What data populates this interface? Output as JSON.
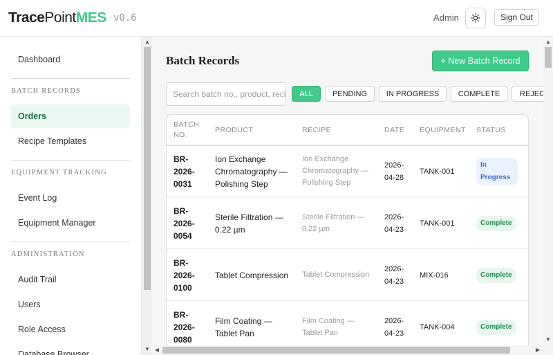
{
  "brand": {
    "part1": "Trace",
    "part2": "Point",
    "part3": "MES",
    "version": "v0.6"
  },
  "header": {
    "user": "Admin",
    "theme_icon": "sun-icon",
    "signout": "Sign Out"
  },
  "sidebar": {
    "dashboard": "Dashboard",
    "section_batch": "BATCH RECORDS",
    "orders": "Orders",
    "recipe_templates": "Recipe Templates",
    "section_equipment": "EQUIPMENT TRACKING",
    "event_log": "Event Log",
    "equipment_manager": "Equipment Manager",
    "section_admin": "ADMINISTRATION",
    "audit_trail": "Audit Trail",
    "users": "Users",
    "role_access": "Role Access",
    "database_browser": "Database Browser",
    "active_item": "Orders"
  },
  "main": {
    "title": "Batch Records",
    "new_button": "+ New Batch Record",
    "search_placeholder": "Search batch no., product, recipe",
    "filters": [
      "ALL",
      "PENDING",
      "IN PROGRESS",
      "COMPLETE",
      "REJECTED"
    ],
    "active_filter": "ALL"
  },
  "table": {
    "headers": {
      "batch": "BATCH NO.",
      "product": "PRODUCT",
      "recipe": "RECIPE",
      "date": "DATE",
      "equipment": "EQUIPMENT",
      "status": "STATUS"
    },
    "rows": [
      {
        "batch": "BR-2026-0031",
        "product": "Ion Exchange Chromatography — Polishing Step",
        "recipe": "Ion Exchange Chromatography — Polishing Step",
        "date": "2026-04-28",
        "equipment": "TANK-001",
        "status": "In Progress",
        "status_kind": "progress"
      },
      {
        "batch": "BR-2026-0054",
        "product": "Sterile Filtration — 0.22 µm",
        "recipe": "Sterile Filtration — 0.22 µm",
        "date": "2026-04-23",
        "equipment": "TANK-001",
        "status": "Complete",
        "status_kind": "complete"
      },
      {
        "batch": "BR-2026-0100",
        "product": "Tablet Compression",
        "recipe": "Tablet Compression",
        "date": "2026-04-23",
        "equipment": "MIX-016",
        "status": "Complete",
        "status_kind": "complete"
      },
      {
        "batch": "BR-2026-0080",
        "product": "Film Coating — Tablet Pan",
        "recipe": "Film Coating — Tablet Pan",
        "date": "2026-04-23",
        "equipment": "TANK-004",
        "status": "Complete",
        "status_kind": "complete"
      }
    ]
  },
  "colors": {
    "accent": "#3fca88",
    "progress": "#3a6fc4",
    "complete": "#258a52"
  }
}
